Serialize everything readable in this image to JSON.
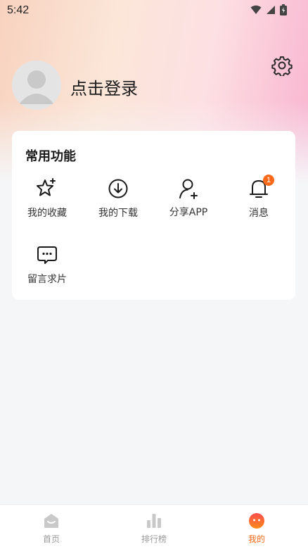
{
  "status_bar": {
    "time": "5:42"
  },
  "profile": {
    "login_label": "点击登录"
  },
  "functions": {
    "title": "常用功能",
    "items": [
      {
        "label": "我的收藏",
        "icon": "star-sparkle-icon"
      },
      {
        "label": "我的下载",
        "icon": "download-icon"
      },
      {
        "label": "分享APP",
        "icon": "add-user-icon"
      },
      {
        "label": "消息",
        "icon": "bell-icon",
        "badge": "1"
      },
      {
        "label": "留言求片",
        "icon": "message-icon"
      }
    ]
  },
  "tabbar": {
    "tabs": [
      {
        "label": "首页",
        "icon": "home-icon"
      },
      {
        "label": "排行榜",
        "icon": "bar-chart-icon"
      },
      {
        "label": "我的",
        "icon": "profile-face-icon",
        "active": true
      }
    ]
  },
  "colors": {
    "accent": "#ff6a1a",
    "background": "#f5f6f8",
    "inactive": "#9a9a9a"
  }
}
